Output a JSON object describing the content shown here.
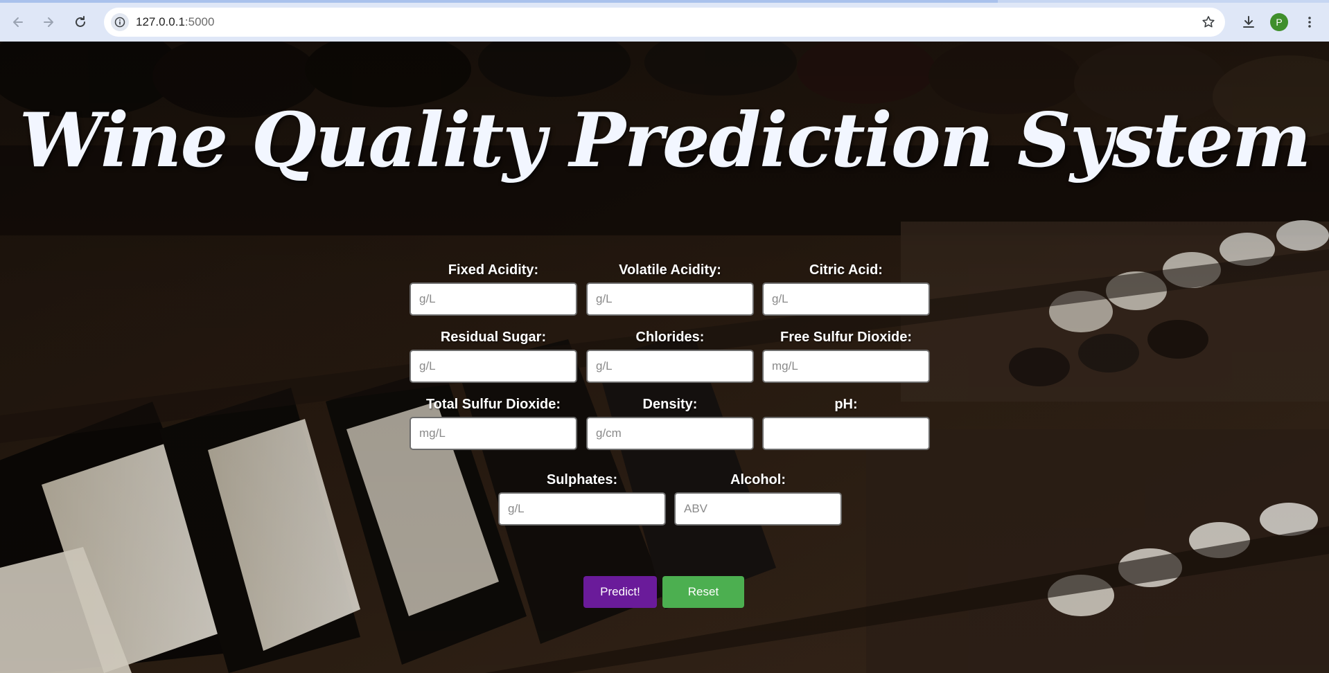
{
  "browser": {
    "url_host": "127.0.0.1",
    "url_port": ":5000",
    "profile_initial": "P"
  },
  "page": {
    "title": "Wine Quality Prediction System",
    "fields": [
      {
        "label": "Fixed Acidity:",
        "placeholder": "g/L",
        "value": ""
      },
      {
        "label": "Volatile Acidity:",
        "placeholder": "g/L",
        "value": ""
      },
      {
        "label": "Citric Acid:",
        "placeholder": "g/L",
        "value": ""
      },
      {
        "label": "Residual Sugar:",
        "placeholder": "g/L",
        "value": ""
      },
      {
        "label": "Chlorides:",
        "placeholder": "g/L",
        "value": ""
      },
      {
        "label": "Free Sulfur Dioxide:",
        "placeholder": "mg/L",
        "value": ""
      },
      {
        "label": "Total Sulfur Dioxide:",
        "placeholder": "mg/L",
        "value": ""
      },
      {
        "label": "Density:",
        "placeholder": "g/cm",
        "value": ""
      },
      {
        "label": "pH:",
        "placeholder": "",
        "value": ""
      },
      {
        "label": "Sulphates:",
        "placeholder": "g/L",
        "value": ""
      },
      {
        "label": "Alcohol:",
        "placeholder": "ABV",
        "value": ""
      }
    ],
    "predict_label": "Predict!",
    "reset_label": "Reset"
  },
  "colors": {
    "predict_button": "#6a1b9a",
    "reset_button": "#4caf50",
    "title_text": "#f2f6ff"
  },
  "icons": [
    "back-arrow-icon",
    "forward-arrow-icon",
    "reload-icon",
    "site-info-icon",
    "bookmark-star-icon",
    "download-icon",
    "kebab-menu-icon"
  ]
}
